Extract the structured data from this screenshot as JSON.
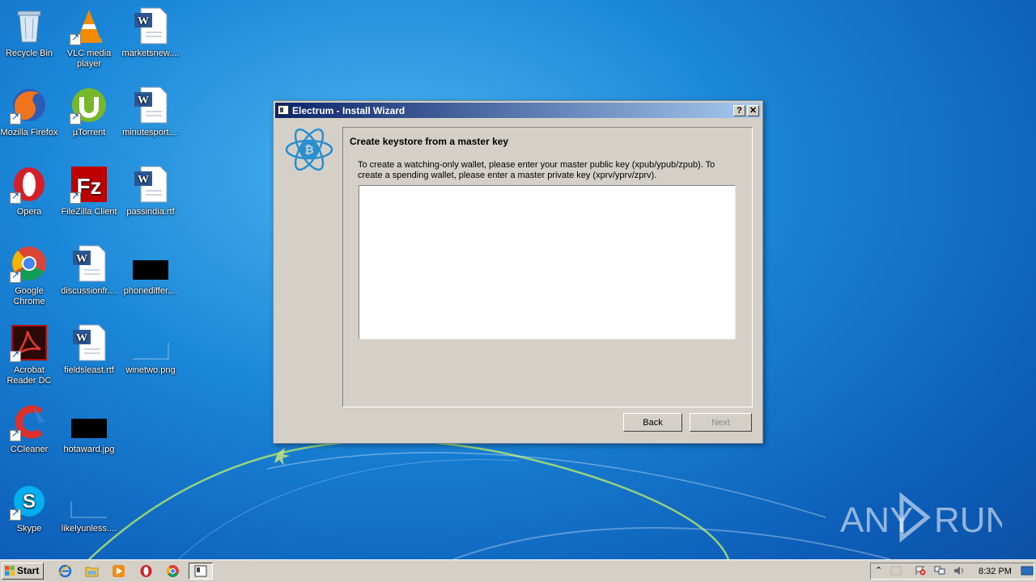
{
  "desktop_icons": [
    {
      "label": "Recycle Bin",
      "icon": "recycle-bin-icon"
    },
    {
      "label": "VLC media player",
      "icon": "vlc-icon"
    },
    {
      "label": "marketsnew....",
      "icon": "word-doc-icon"
    },
    {
      "label": "Mozilla Firefox",
      "icon": "firefox-icon"
    },
    {
      "label": "µTorrent",
      "icon": "utorrent-icon"
    },
    {
      "label": "minutesport....",
      "icon": "word-doc-icon"
    },
    {
      "label": "Opera",
      "icon": "opera-icon"
    },
    {
      "label": "FileZilla Client",
      "icon": "filezilla-icon"
    },
    {
      "label": "passindia.rtf",
      "icon": "word-doc-icon"
    },
    {
      "label": "Google Chrome",
      "icon": "chrome-icon"
    },
    {
      "label": "discussionfr....",
      "icon": "word-doc-icon"
    },
    {
      "label": "phonediffer....",
      "icon": "image-thumbnail-icon"
    },
    {
      "label": "Acrobat Reader DC",
      "icon": "acrobat-icon"
    },
    {
      "label": "fieldsleast.rtf",
      "icon": "word-doc-icon"
    },
    {
      "label": "winetwo.png",
      "icon": "image-thumbnail-icon"
    },
    {
      "label": "CCleaner",
      "icon": "ccleaner-icon"
    },
    {
      "label": "hotaward.jpg",
      "icon": "image-thumbnail-icon"
    },
    {
      "label": "Skype",
      "icon": "skype-icon"
    },
    {
      "label": "likelyunless....",
      "icon": "image-thumbnail-icon"
    }
  ],
  "window": {
    "title": "Electrum  -  Install Wizard",
    "help_label": "?",
    "close_label": "✕",
    "heading": "Create keystore from a master key",
    "description": "To create a watching-only wallet, please enter your master public key (xpub/ypub/zpub). To create a spending wallet, please enter a master private key (xprv/yprv/zprv).",
    "key_input_value": "",
    "back_label": "Back",
    "next_label": "Next",
    "next_enabled": false
  },
  "taskbar": {
    "start_label": "Start",
    "clock": "8:32 PM"
  },
  "watermark": {
    "text_left": "ANY",
    "text_right": "RUN"
  },
  "colors": {
    "titlebar_start": "#0a246a",
    "titlebar_end": "#a6caf0",
    "electrum_blue": "#2a8fd0"
  }
}
